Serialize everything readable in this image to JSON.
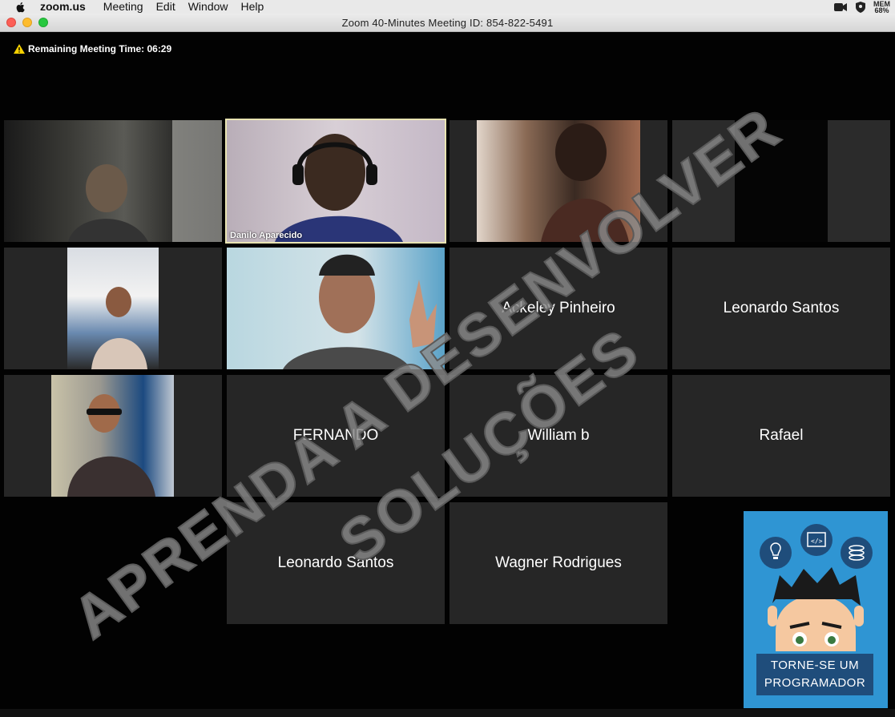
{
  "menubar": {
    "app": "zoom.us",
    "items": [
      "Meeting",
      "Edit",
      "Window",
      "Help"
    ],
    "battery_label": "MEM",
    "battery_value": "68%"
  },
  "window": {
    "title": "Zoom   40-Minutes Meeting ID: 854-822-5491"
  },
  "meeting": {
    "remaining": "Remaining Meeting Time: 06:29"
  },
  "participants": {
    "danilo": "Danilo Aparecido",
    "ackeley": "Ackeley Pinheiro",
    "leonardo_1": "Leonardo Santos",
    "fernando": "FERNANDO",
    "william": "William b",
    "rafael": "Rafael",
    "leonardo_2": "Leonardo Santos",
    "wagner": "Wagner Rodrigues"
  },
  "watermark": {
    "line1": "APRENDA A DESENVOLVER",
    "line2": "SOLUÇÕES"
  },
  "ad": {
    "line1": "TORNE-SE UM",
    "line2": "PROGRAMADOR"
  },
  "colors": {
    "tile_bg": "#262626",
    "active_border": "#e9e4b2",
    "ad_bg": "#2f95d3",
    "ad_plate": "#1f4d7b"
  }
}
